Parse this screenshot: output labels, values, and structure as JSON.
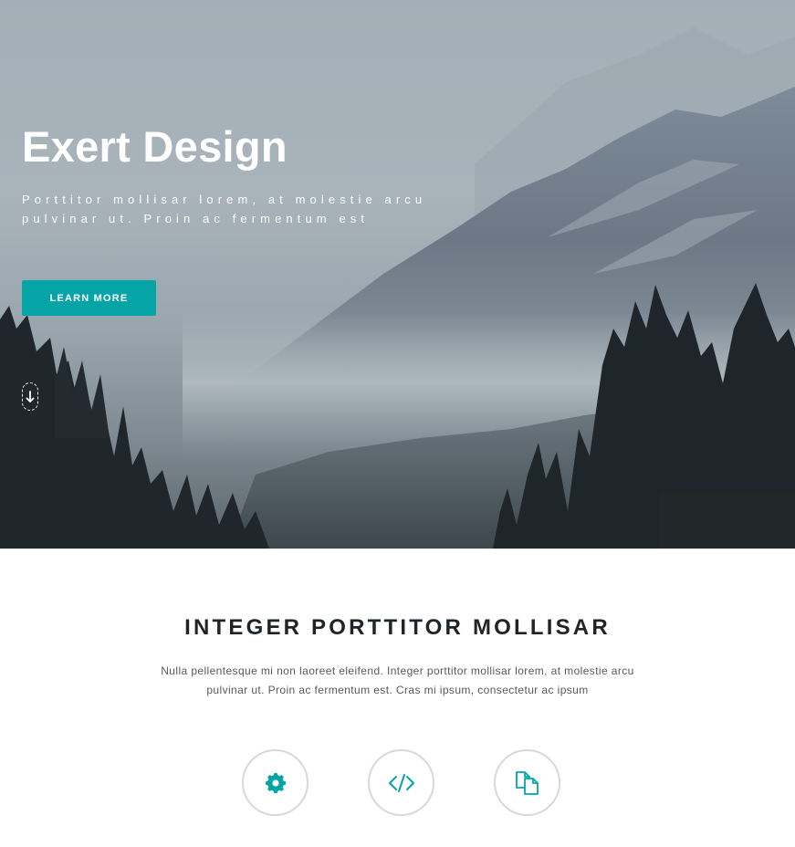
{
  "hero": {
    "title": "Exert Design",
    "subtitle": "Porttitor mollisar lorem, at molestie arcu pulvinar ut. Proin ac fermentum est",
    "cta_label": "LEARN MORE",
    "scroll_icon": "arrow-down-icon"
  },
  "section": {
    "title": "INTEGER PORTTITOR MOLLISAR",
    "description": "Nulla pellentesque mi non laoreet eleifend. Integer porttitor mollisar lorem, at molestie arcu pulvinar ut. Proin ac fermentum est. Cras mi ipsum, consectetur ac ipsum",
    "features": [
      {
        "icon": "gear-icon"
      },
      {
        "icon": "code-icon"
      },
      {
        "icon": "copy-files-icon"
      }
    ]
  },
  "colors": {
    "accent": "#05a4a6",
    "heading": "#1f2428",
    "body_text": "#555a5e",
    "circle_border": "#d6d9db"
  }
}
